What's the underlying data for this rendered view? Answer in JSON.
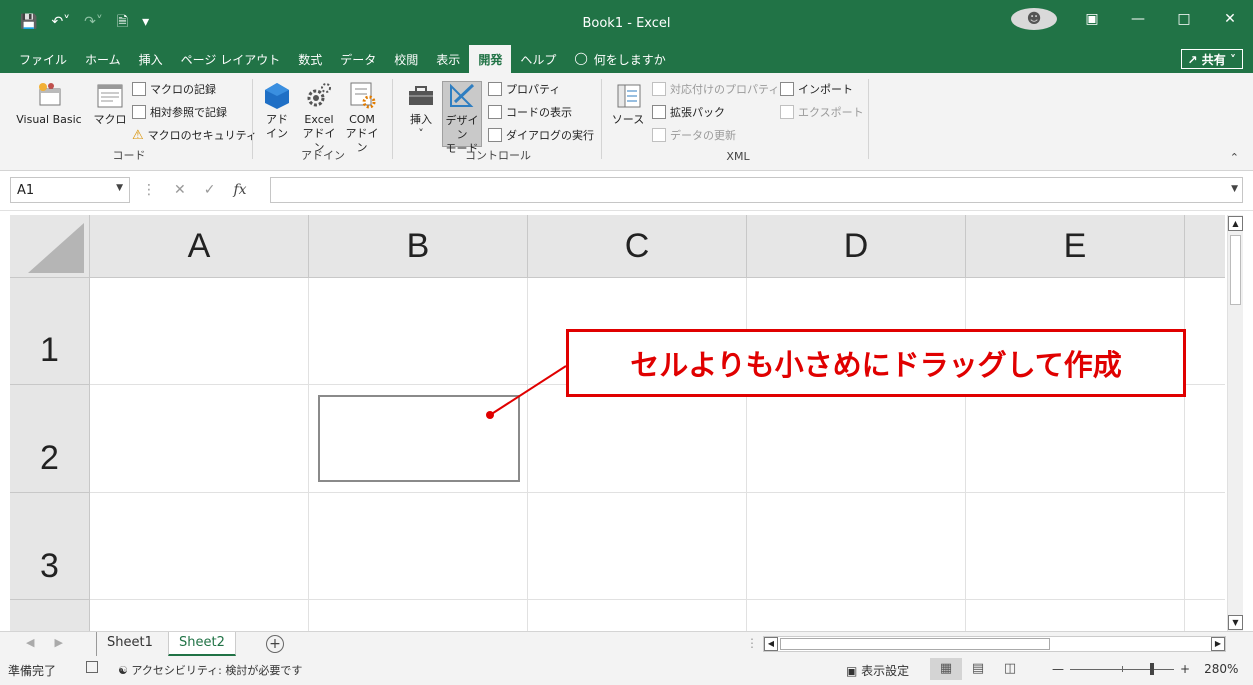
{
  "window": {
    "title": "Book1  -  Excel",
    "share_label": "共有"
  },
  "quick_access": [
    "save-icon",
    "undo-icon",
    "redo-icon",
    "print-preview-icon",
    "customize-icon"
  ],
  "tabs": [
    "ファイル",
    "ホーム",
    "挿入",
    "ページ レイアウト",
    "数式",
    "データ",
    "校閲",
    "表示",
    "開発",
    "ヘルプ"
  ],
  "active_tab": "開発",
  "tell_me": "何をしますか",
  "ribbon": {
    "code": {
      "label": "コード",
      "visual_basic": "Visual Basic",
      "macro": "マクロ",
      "record_macro": "マクロの記録",
      "relative_ref": "相対参照で記録",
      "macro_security": "マクロのセキュリティ"
    },
    "addins": {
      "label": "アドイン",
      "addin_l1": "アド",
      "addin_l2": "イン",
      "excel_l1": "Excel",
      "excel_l2": "アドイン",
      "com_l1": "COM",
      "com_l2": "アドイン"
    },
    "controls": {
      "label": "コントロール",
      "insert": "挿入",
      "design_l1": "デザイン",
      "design_l2": "モード",
      "properties": "プロパティ",
      "view_code": "コードの表示",
      "run_dialog": "ダイアログの実行"
    },
    "xml": {
      "label": "XML",
      "source": "ソース",
      "map_props": "対応付けのプロパティ",
      "expansion": "拡張パック",
      "refresh": "データの更新",
      "import": "インポート",
      "export": "エクスポート"
    }
  },
  "formula_bar": {
    "name_box": "A1",
    "fx": "fx",
    "value": ""
  },
  "columns": [
    "A",
    "B",
    "C",
    "D",
    "E"
  ],
  "rows": [
    "1",
    "2",
    "3"
  ],
  "callout_text": "セルよりも小さめにドラッグして作成",
  "sheets": [
    "Sheet1",
    "Sheet2"
  ],
  "active_sheet": "Sheet2",
  "status": {
    "ready": "準備完了",
    "accessibility": "アクセシビリティ: 検討が必要です",
    "display_settings": "表示設定",
    "zoom": "280%"
  },
  "colors": {
    "excel_green": "#217346",
    "callout_red": "#e00000"
  }
}
